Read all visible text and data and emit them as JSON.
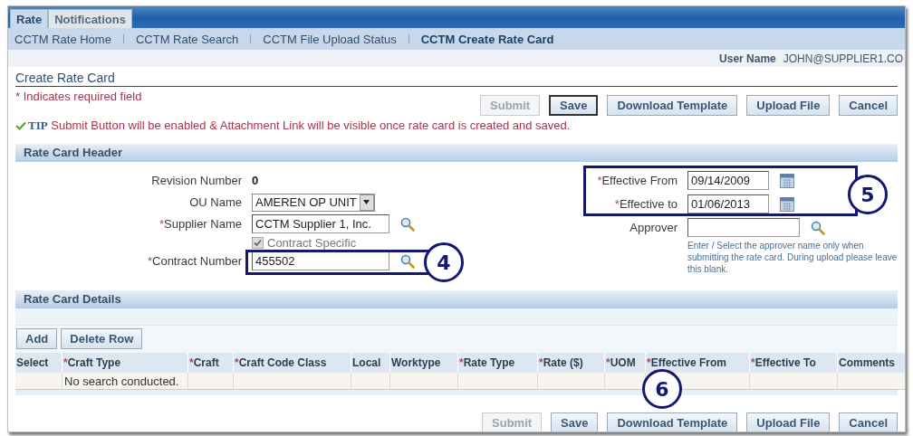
{
  "tabs": [
    {
      "label": "Rate",
      "selected": true
    },
    {
      "label": "Notifications",
      "selected": false
    }
  ],
  "subnav": [
    {
      "label": "CCTM Rate Home",
      "selected": false
    },
    {
      "label": "CCTM Rate Search",
      "selected": false
    },
    {
      "label": "CCTM File Upload Status",
      "selected": false
    },
    {
      "label": "CCTM Create Rate Card",
      "selected": true
    }
  ],
  "user": {
    "label": "User Name",
    "value": "JOHN@SUPPLIER1.CO"
  },
  "page_title": "Create Rate Card",
  "required_note": "* Indicates required field",
  "top_buttons": [
    {
      "label": "Submit",
      "disabled": true,
      "focused": false
    },
    {
      "label": "Save",
      "disabled": false,
      "focused": true
    },
    {
      "label": "Download Template",
      "disabled": false,
      "focused": false
    },
    {
      "label": "Upload File",
      "disabled": false,
      "focused": false
    },
    {
      "label": "Cancel",
      "disabled": false,
      "focused": false
    }
  ],
  "tip": {
    "label": "TIP",
    "text": "Submit Button will be enabled & Attachment Link will be visible once rate card is created and saved."
  },
  "header": {
    "title": "Rate Card Header",
    "left": [
      {
        "kind": "text",
        "label": "Revision Number",
        "value": "0"
      },
      {
        "kind": "select",
        "label": "OU Name",
        "value": "AMEREN OP UNIT"
      },
      {
        "kind": "lookup",
        "label": "Supplier Name",
        "required_mark": "*",
        "value": "CCTM Supplier 1, Inc."
      },
      {
        "kind": "checkbox",
        "label": "Contract Specific",
        "checked": true,
        "disabled": true
      },
      {
        "kind": "lookup",
        "label": "Contract Number",
        "required_mark": "*",
        "value": "455502"
      }
    ],
    "right": [
      {
        "kind": "date",
        "label": "Effective From",
        "required_mark": "*",
        "value": "09/14/2009"
      },
      {
        "kind": "date",
        "label": "Effective to",
        "required_mark": "*",
        "value": "01/06/2013"
      },
      {
        "kind": "lookup",
        "label": "Approver"
      }
    ],
    "approver_hint": "Enter / Select the approver name only when submitting the rate card. During upload please leave this blank."
  },
  "details": {
    "title": "Rate Card Details",
    "actions": [
      "Add",
      "Delete Row"
    ],
    "columns": [
      {
        "label": "Select"
      },
      {
        "label": "Craft Type",
        "required_mark": "*"
      },
      {
        "label": "Craft",
        "required_mark": "*"
      },
      {
        "label": "Craft Code Class",
        "required_mark": "*"
      },
      {
        "label": "Local"
      },
      {
        "label": "Worktype"
      },
      {
        "label": "Rate Type",
        "required_mark": "*"
      },
      {
        "label": "Rate ($)",
        "required_mark": "*"
      },
      {
        "label": "UOM",
        "required_mark": "*"
      },
      {
        "label": "Effective From",
        "required_mark": "*"
      },
      {
        "label": "Effective To",
        "required_mark": "*"
      },
      {
        "label": "Comments"
      }
    ],
    "empty_message": "No search conducted."
  },
  "bottom_buttons": [
    {
      "label": "Submit",
      "disabled": true,
      "focused": false
    },
    {
      "label": "Save",
      "disabled": false,
      "focused": false
    },
    {
      "label": "Download Template",
      "disabled": false,
      "focused": false
    },
    {
      "label": "Upload File",
      "disabled": false,
      "focused": false
    },
    {
      "label": "Cancel",
      "disabled": false,
      "focused": false
    }
  ],
  "callouts": [
    {
      "number": "4",
      "kind": "boxed"
    },
    {
      "number": "5",
      "kind": "boxed"
    },
    {
      "number": "6",
      "kind": "plain"
    }
  ]
}
